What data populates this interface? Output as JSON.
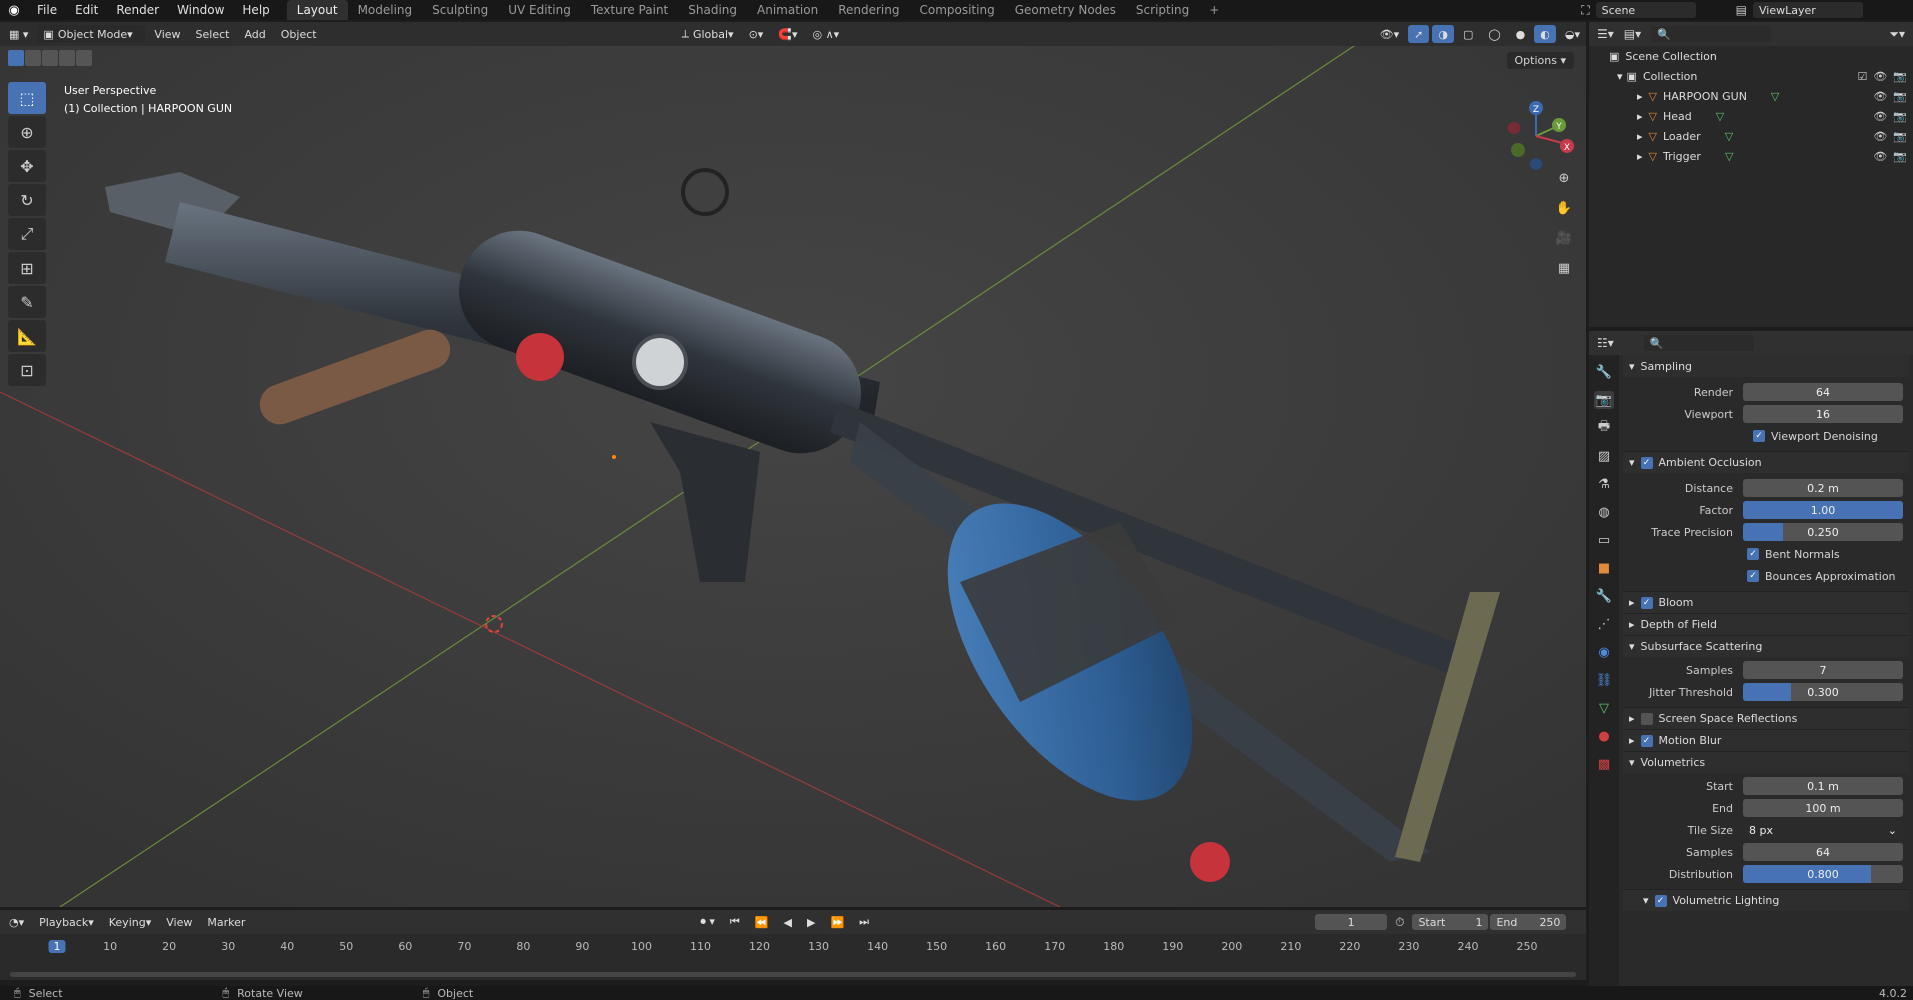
{
  "menu": [
    "File",
    "Edit",
    "Render",
    "Window",
    "Help"
  ],
  "workspaces": [
    "Layout",
    "Modeling",
    "Sculpting",
    "UV Editing",
    "Texture Paint",
    "Shading",
    "Animation",
    "Rendering",
    "Compositing",
    "Geometry Nodes",
    "Scripting"
  ],
  "add_workspace": "+",
  "scene": "Scene",
  "view_layer": "ViewLayer",
  "viewport": {
    "mode": "Object Mode",
    "menus": [
      "View",
      "Select",
      "Add",
      "Object"
    ],
    "orientation": "Global",
    "options": "Options",
    "perspective": "User Perspective",
    "context": "(1) Collection | HARPOON GUN",
    "gizmo": {
      "x": "X",
      "y": "Y",
      "z": "Z"
    }
  },
  "outliner": {
    "scene_collection": "Scene Collection",
    "collection": "Collection",
    "items": [
      "HARPOON GUN",
      "Head",
      "Loader",
      "Trigger"
    ]
  },
  "props": {
    "sampling": "Sampling",
    "render_label": "Render",
    "render_val": "64",
    "viewport_label": "Viewport",
    "viewport_val": "16",
    "viewport_denoising": "Viewport Denoising",
    "ao": "Ambient Occlusion",
    "distance_label": "Distance",
    "distance_val": "0.2 m",
    "factor_label": "Factor",
    "factor_val": "1.00",
    "factor_fill": 1.0,
    "trace_label": "Trace Precision",
    "trace_val": "0.250",
    "trace_fill": 0.25,
    "bent_normals": "Bent Normals",
    "bounces": "Bounces Approximation",
    "bloom": "Bloom",
    "dof": "Depth of Field",
    "sss": "Subsurface Scattering",
    "sss_samples_label": "Samples",
    "sss_samples_val": "7",
    "jitter_label": "Jitter Threshold",
    "jitter_val": "0.300",
    "jitter_fill": 0.3,
    "ssr": "Screen Space Reflections",
    "motion_blur": "Motion Blur",
    "volumetrics": "Volumetrics",
    "start_label": "Start",
    "start_val": "0.1 m",
    "end_label": "End",
    "end_val": "100 m",
    "tile_label": "Tile Size",
    "tile_val": "8 px",
    "vsamples_label": "Samples",
    "vsamples_val": "64",
    "dist_label": "Distribution",
    "dist_val": "0.800",
    "dist_fill": 0.8,
    "vol_lighting": "Volumetric Lighting"
  },
  "timeline": {
    "menus": [
      "Playback",
      "Keying",
      "View",
      "Marker"
    ],
    "current_frame": "1",
    "start_label": "Start",
    "start_val": "1",
    "end_label": "End",
    "end_val": "250",
    "ticks": [
      "1",
      "10",
      "20",
      "30",
      "40",
      "50",
      "60",
      "70",
      "80",
      "90",
      "100",
      "110",
      "120",
      "130",
      "140",
      "150",
      "160",
      "170",
      "180",
      "190",
      "200",
      "210",
      "220",
      "230",
      "240",
      "250"
    ]
  },
  "status": {
    "select": "Select",
    "rotate": "Rotate View",
    "object": "Object",
    "version": "4.0.2"
  }
}
